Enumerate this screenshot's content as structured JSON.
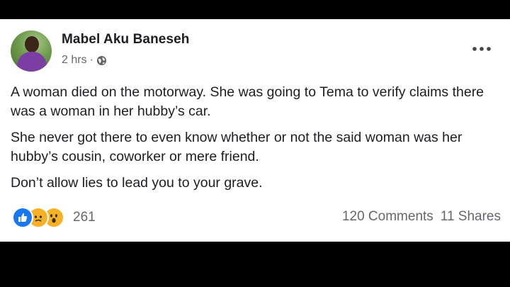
{
  "post": {
    "author": "Mabel Aku Baneseh",
    "time": "2 hrs",
    "separator": "·",
    "privacy_icon": "globe-icon",
    "paragraphs": [
      "A woman died on the motorway. She was going to Tema to verify claims there was a woman in her hubby’s car.",
      "She never got there to even know whether or not the said woman was her hubby’s cousin, coworker or mere friend.",
      "Don’t allow lies to lead you to your grave."
    ],
    "reactions": {
      "icons": [
        "like-icon",
        "sad-icon",
        "wow-icon"
      ],
      "count": "261"
    },
    "comments": "120 Comments",
    "shares": "11 Shares"
  },
  "colors": {
    "background": "#000000",
    "card": "#ffffff",
    "text": "#1c1e21",
    "muted": "#65676b",
    "like_blue": "#1877f2",
    "emoji_yellow": "#f7b125"
  }
}
